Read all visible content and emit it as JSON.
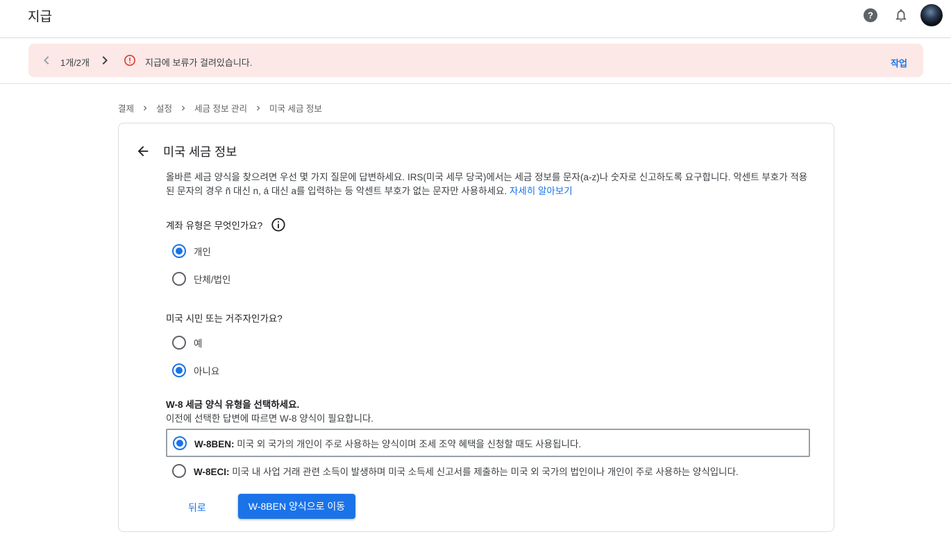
{
  "header": {
    "title": "지급"
  },
  "alert": {
    "pager": "1개/2개",
    "message": "지급에 보류가 걸려있습니다.",
    "action": "작업"
  },
  "breadcrumb": [
    "결제",
    "설정",
    "세금 정보 관리",
    "미국 세금 정보"
  ],
  "card": {
    "title": "미국 세금 정보",
    "intro": "올바른 세금 양식을 찾으려면 우선 몇 가지 질문에 답변하세요. IRS(미국 세무 당국)에서는 세금 정보를 문자(a-z)나 숫자로 신고하도록 요구합니다. 악센트 부호가 적용된 문자의 경우 ñ 대신 n, á 대신 a를 입력하는 등 악센트 부호가 없는 문자만 사용하세요.",
    "learn_more": "자세히 알아보기"
  },
  "account_type": {
    "question": "계좌 유형은 무엇인가요?",
    "options": [
      {
        "label": "개인",
        "selected": true
      },
      {
        "label": "단체/법인",
        "selected": false
      }
    ]
  },
  "us_person": {
    "question": "미국 시민 또는 거주자인가요?",
    "options": [
      {
        "label": "예",
        "selected": false
      },
      {
        "label": "아니요",
        "selected": true
      }
    ]
  },
  "w8": {
    "heading": "W-8 세금 양식 유형을 선택하세요.",
    "subtext": "이전에 선택한 답변에 따르면 W-8 양식이 필요합니다.",
    "options": [
      {
        "code": "W-8BEN:",
        "desc": " 미국 외 국가의 개인이 주로 사용하는 양식이며 조세 조약 혜택을 신청할 때도 사용됩니다.",
        "selected": true
      },
      {
        "code": "W-8ECI:",
        "desc": " 미국 내 사업 거래 관련 소득이 발생하며 미국 소득세 신고서를 제출하는 미국 외 국가의 법인이나 개인이 주로 사용하는 양식입니다.",
        "selected": false
      }
    ]
  },
  "buttons": {
    "back": "뒤로",
    "continue": "W-8BEN 양식으로 이동"
  },
  "colors": {
    "accent": "#1a73e8",
    "alert_bg": "#fce8e6",
    "error": "#d93025"
  },
  "icons": [
    "help-icon",
    "bell-icon",
    "avatar",
    "chevron-left-icon",
    "chevron-right-icon",
    "error-icon",
    "arrow-back-icon",
    "info-icon"
  ]
}
